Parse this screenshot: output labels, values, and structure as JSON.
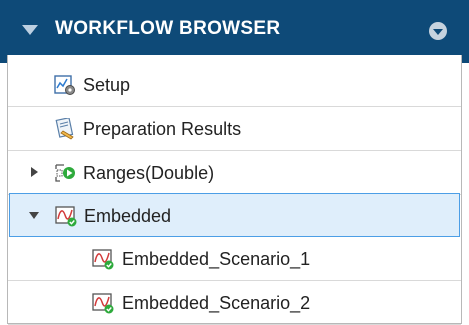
{
  "header": {
    "title": "WORKFLOW BROWSER"
  },
  "tree": {
    "items": [
      {
        "label": "Setup",
        "icon": "setup-icon",
        "level": 0,
        "expander": "none"
      },
      {
        "label": "Preparation Results",
        "icon": "preparation-results-icon",
        "level": 0,
        "expander": "none"
      },
      {
        "label": "Ranges(Double)",
        "icon": "ranges-icon",
        "level": 0,
        "expander": "collapsed"
      },
      {
        "label": "Embedded",
        "icon": "embedded-icon",
        "level": 0,
        "expander": "expanded",
        "selected": true
      },
      {
        "label": "Embedded_Scenario_1",
        "icon": "scenario-icon",
        "level": 1,
        "expander": "none"
      },
      {
        "label": "Embedded_Scenario_2",
        "icon": "scenario-icon",
        "level": 1,
        "expander": "none"
      }
    ]
  },
  "colors": {
    "header_bg": "#0e4a78",
    "selection_bg": "#dfeefb",
    "selection_border": "#4c9ee6",
    "status_ok": "#2eaa3c"
  }
}
